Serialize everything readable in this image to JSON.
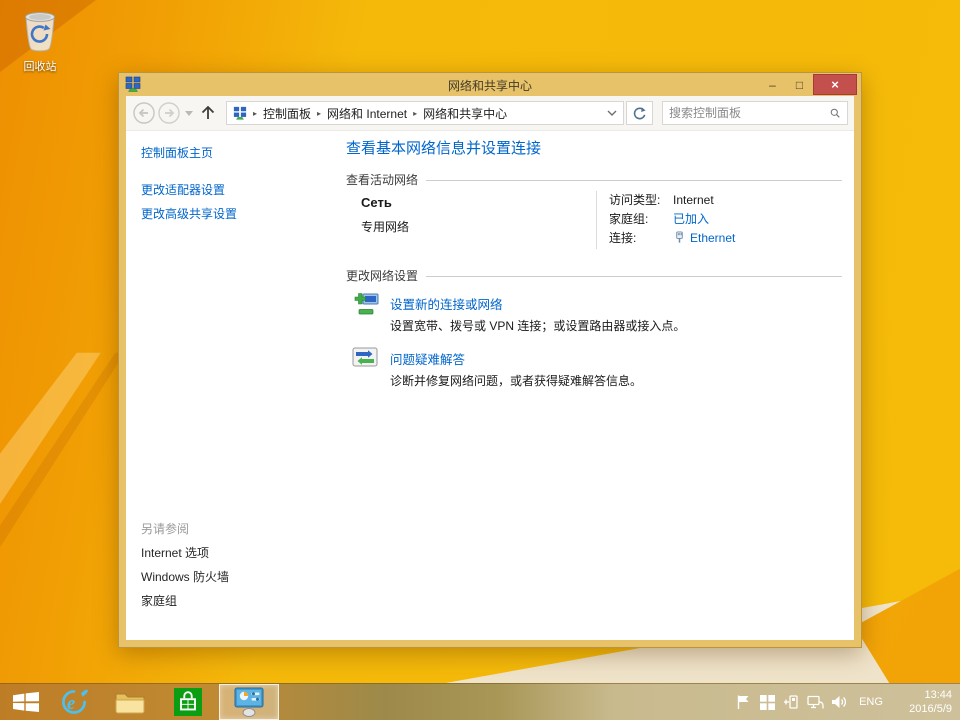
{
  "desktop": {
    "recycle_bin_label": "回收站"
  },
  "window": {
    "title": "网络和共享中心",
    "controls": {
      "minimize": "–",
      "maximize": "□",
      "close": "×"
    }
  },
  "toolbar": {
    "breadcrumb_items": [
      "控制面板",
      "网络和 Internet",
      "网络和共享中心"
    ],
    "breadcrumb_separator": "▸",
    "search_placeholder": "搜索控制面板"
  },
  "sidebar": {
    "home_link": "控制面板主页",
    "links": [
      "更改适配器设置",
      "更改高级共享设置"
    ],
    "see_also_heading": "另请参阅",
    "see_also_links": [
      "Internet 选项",
      "Windows 防火墙",
      "家庭组"
    ]
  },
  "main": {
    "page_title": "查看基本网络信息并设置连接",
    "active_networks_label": "查看活动网络",
    "network": {
      "name": "Сеть",
      "type": "专用网络",
      "access_label": "访问类型:",
      "access_value": "Internet",
      "homegroup_label": "家庭组:",
      "homegroup_value": "已加入",
      "connection_label": "连接:",
      "connection_value": "Ethernet"
    },
    "change_settings_label": "更改网络设置",
    "tasks": [
      {
        "title": "设置新的连接或网络",
        "description": "设置宽带、拨号或 VPN 连接；或设置路由器或接入点。"
      },
      {
        "title": "问题疑难解答",
        "description": "诊断并修复网络问题，或者获得疑难解答信息。"
      }
    ]
  },
  "taskbar": {
    "language": "ENG",
    "time": "13:44",
    "date": "2016/5/9"
  },
  "colors": {
    "window_chrome": "#e7c269",
    "close_button": "#c4504e",
    "link_blue": "#0066cc",
    "wallpaper_gold": "#f5ba09",
    "wallpaper_orange": "#ee8f02",
    "wallpaper_cream": "#efe5cf"
  }
}
